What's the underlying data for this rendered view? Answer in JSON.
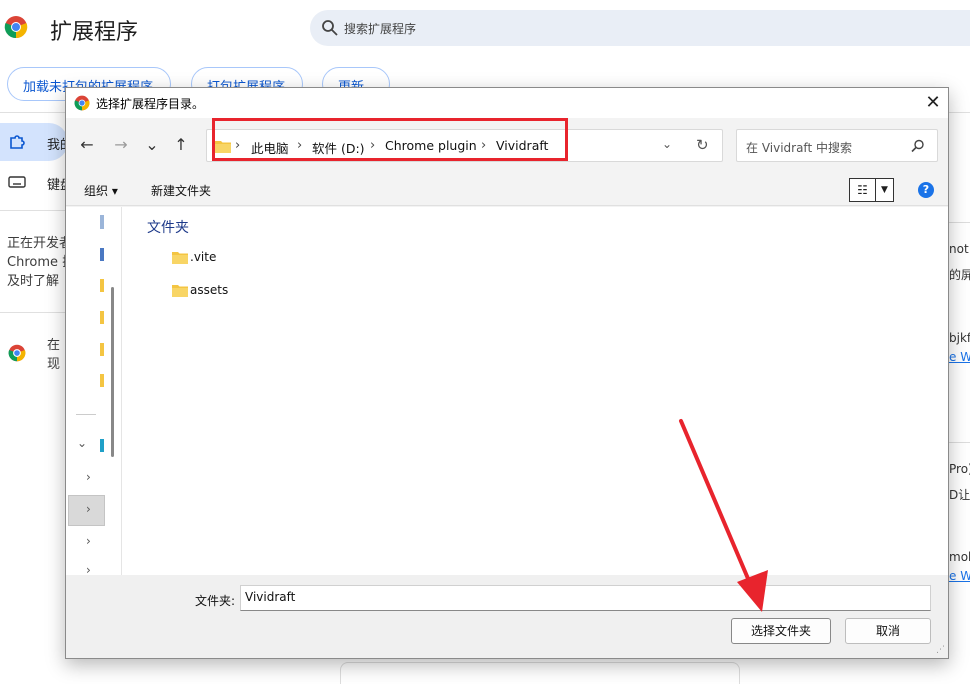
{
  "background_page": {
    "title": "扩展程序",
    "search_placeholder": "搜索扩展程序",
    "buttons": [
      "加载未打包的扩展程序",
      "打包扩展程序",
      "更新"
    ],
    "sidebar": [
      {
        "label": "我的扩展程序",
        "icon": "puzzle-icon"
      },
      {
        "label": "键盘快捷键",
        "icon": "keyboard-icon"
      }
    ],
    "dev_notice_lines": [
      "正在开发者模式下运行",
      "Chrome 扩展程序",
      "及时了解"
    ],
    "promo_lines": [
      "在",
      "现"
    ],
    "right_card_fragments": [
      [
        "not",
        "的屏",
        "bjkf",
        "e W"
      ],
      [
        "Pro)",
        "D让",
        "mob",
        "e W"
      ]
    ]
  },
  "dialog": {
    "title": "选择扩展程序目录。",
    "close_label": "✕",
    "nav": {
      "back": "←",
      "forward": "→",
      "recent": "⌄",
      "up": "↑"
    },
    "breadcrumb": [
      "此电脑",
      "软件 (D:)",
      "Chrome plugin",
      "Vividraft"
    ],
    "search_placeholder": "在 Vividraft 中搜索",
    "toolbar": {
      "organize": "组织 ▾",
      "new_folder": "新建文件夹",
      "help": "?"
    },
    "group_title": "文件夹",
    "items": [
      {
        "name": ".vite",
        "type": "folder"
      },
      {
        "name": "assets",
        "type": "folder"
      }
    ],
    "folder_label": "文件夹:",
    "folder_value": "Vividraft",
    "select_button": "选择文件夹",
    "cancel_button": "取消"
  },
  "colors": {
    "accent": "#0b57d0",
    "annotation": "#e8242d",
    "folder": "#f4c542"
  }
}
